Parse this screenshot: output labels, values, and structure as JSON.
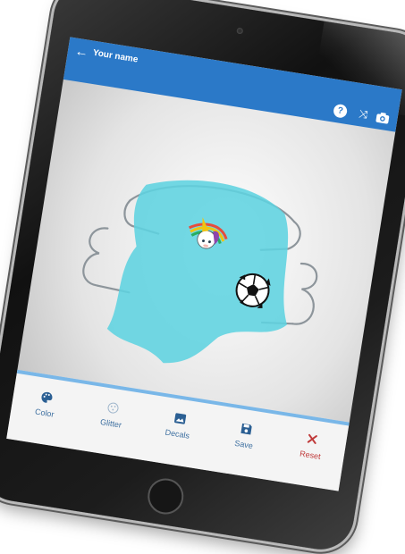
{
  "header": {
    "back_icon": "arrow-left-icon",
    "title": "Your name",
    "actions": [
      {
        "name": "help",
        "icon": "help-icon",
        "glyph": "?"
      },
      {
        "name": "shuffle",
        "icon": "shuffle-icon",
        "glyph": "⤨"
      },
      {
        "name": "camera",
        "icon": "camera-icon"
      }
    ]
  },
  "toolbar": {
    "items": [
      {
        "label": "Color",
        "icon": "palette-icon"
      },
      {
        "label": "Glitter",
        "icon": "glitter-icon"
      },
      {
        "label": "Decals",
        "icon": "image-icon"
      },
      {
        "label": "Save",
        "icon": "save-icon"
      },
      {
        "label": "Reset",
        "icon": "close-icon"
      }
    ]
  },
  "colors": {
    "appbar": "#2b79c8",
    "retainer": "#5fd3e0",
    "toolbar_accent": "#79b7e8",
    "reset": "#c03a3a"
  },
  "decals": [
    "unicorn",
    "soccer-ball"
  ]
}
